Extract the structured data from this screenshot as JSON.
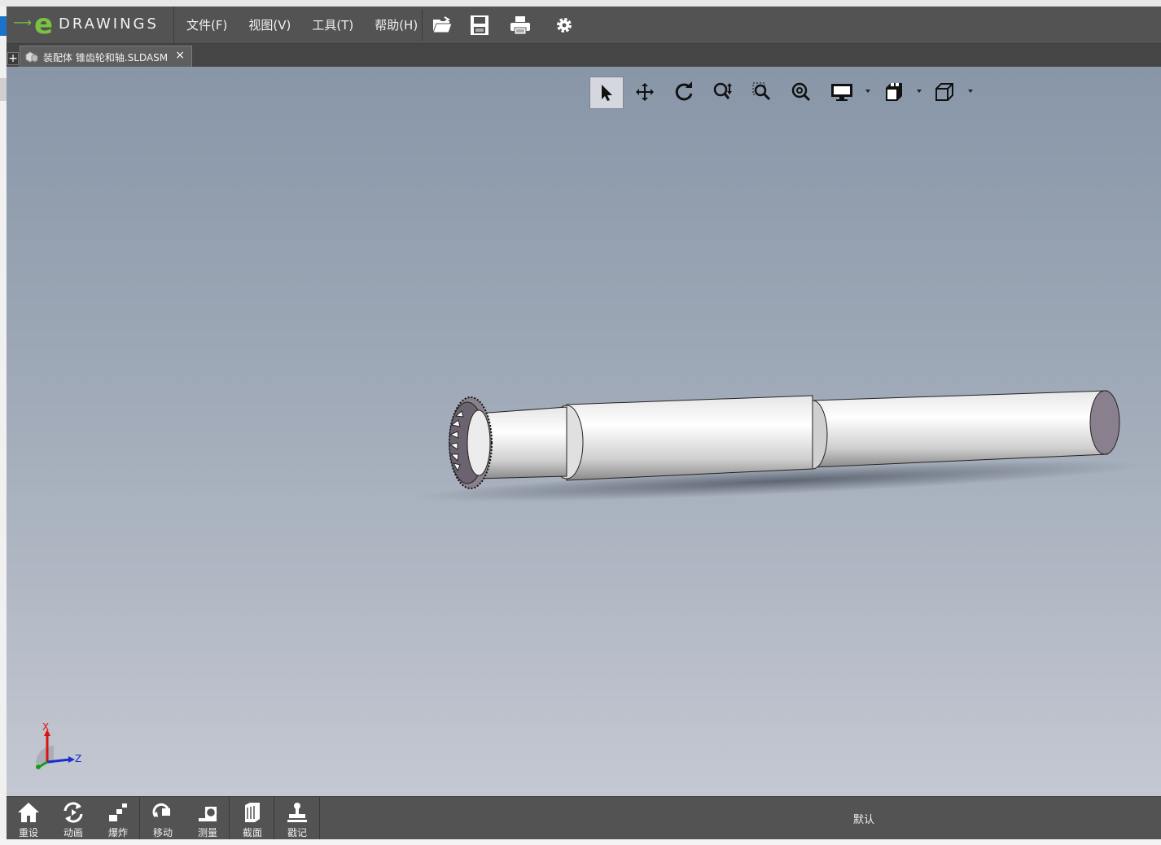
{
  "app": {
    "logo_text": "DRAWINGS",
    "logo_e": "e"
  },
  "menu": [
    "文件(F)",
    "视图(V)",
    "工具(T)",
    "帮助(H)"
  ],
  "toolbar": {
    "icons": [
      "open-folder-icon",
      "save-icon",
      "print-icon",
      "settings-gear-icon"
    ]
  },
  "tab": {
    "plus": "+",
    "label": "装配体 锥齿轮和轴.SLDASM",
    "close": "×"
  },
  "view_toolbar": [
    "select-arrow-icon",
    "pan-icon",
    "rotate-icon",
    "zoom-icon",
    "zoom-to-area-icon",
    "zoom-to-fit-icon",
    "display-style-icon",
    "views-icon",
    "standard-view-icon"
  ],
  "triad": {
    "x": "X",
    "z": "Z"
  },
  "bottom": {
    "buttons": [
      {
        "label": "重设",
        "icon": "home-icon"
      },
      {
        "label": "动画",
        "icon": "animate-icon"
      },
      {
        "label": "爆炸",
        "icon": "explode-icon"
      },
      {
        "label": "移动",
        "icon": "move-icon"
      },
      {
        "label": "测量",
        "icon": "measure-icon"
      },
      {
        "label": "截面",
        "icon": "section-icon"
      },
      {
        "label": "戳记",
        "icon": "stamp-icon"
      }
    ],
    "configuration": "默认"
  },
  "colors": {
    "accent": "#7cc242",
    "toolbar_bg": "#535353",
    "viewport_top": "#8896a8",
    "viewport_bottom": "#c4c8d2"
  }
}
